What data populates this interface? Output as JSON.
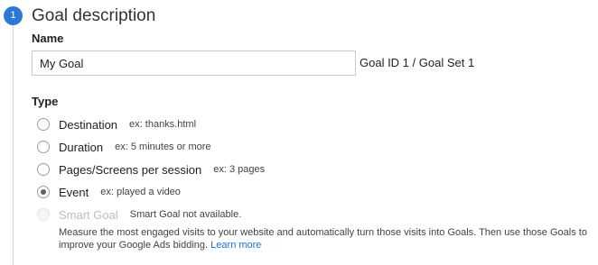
{
  "step": {
    "number": "1"
  },
  "section": {
    "title": "Goal description"
  },
  "name": {
    "label": "Name",
    "value": "My Goal",
    "goal_id_text": "Goal ID 1 / Goal Set 1"
  },
  "type": {
    "label": "Type",
    "options": [
      {
        "label": "Destination",
        "example": "ex: thanks.html",
        "checked": false,
        "disabled": false
      },
      {
        "label": "Duration",
        "example": "ex: 5 minutes or more",
        "checked": false,
        "disabled": false
      },
      {
        "label": "Pages/Screens per session",
        "example": "ex: 3 pages",
        "checked": false,
        "disabled": false
      },
      {
        "label": "Event",
        "example": "ex: played a video",
        "checked": true,
        "disabled": false
      },
      {
        "label": "Smart Goal",
        "example": "Smart Goal not available.",
        "checked": false,
        "disabled": true
      }
    ],
    "smart_description": "Measure the most engaged visits to your website and automatically turn those visits into Goals. Then use those Goals to improve your Google Ads bidding.",
    "learn_more": "Learn more"
  },
  "colors": {
    "step_badge": "#2d78d6",
    "link": "#1a73e8"
  }
}
